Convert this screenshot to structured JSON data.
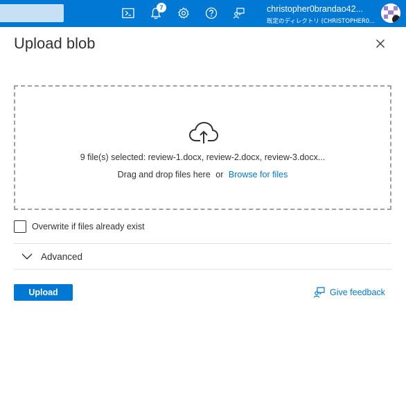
{
  "topbar": {
    "notification_count": "7",
    "user_name": "christopher0brandao42...",
    "user_directory": "既定のディレクトリ (CHRISTOPHER0..."
  },
  "icons": {
    "cloud_shell": "cloud-shell-icon",
    "notifications": "bell-icon",
    "settings": "gear-icon",
    "help": "help-icon",
    "feedback": "feedback-icon"
  },
  "colors": {
    "accent": "#0078d4",
    "search_box": "#c7e0f4"
  },
  "panel": {
    "title": "Upload blob",
    "selected_files": "9 file(s) selected: review-1.docx, review-2.docx, review-3.docx...",
    "drag_text": "Drag and drop files here",
    "or_text": "or",
    "browse_label": "Browse for files",
    "overwrite_label": "Overwrite if files already exist",
    "overwrite_checked": false,
    "advanced_label": "Advanced",
    "upload_label": "Upload",
    "feedback_label": "Give feedback"
  }
}
